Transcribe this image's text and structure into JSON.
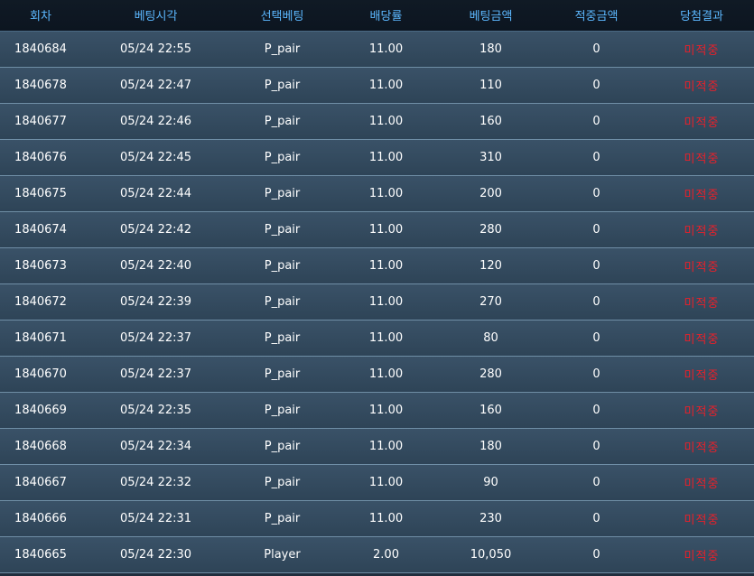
{
  "colors": {
    "header_text": "#5cb8ff",
    "row_text": "#ffffff",
    "result_lose": "#e8202a",
    "row_bg": "#34495e"
  },
  "headers": [
    "회차",
    "베팅시각",
    "선택베팅",
    "배당률",
    "베팅금액",
    "적중금액",
    "당첨결과"
  ],
  "rows": [
    {
      "round": "1840684",
      "time": "05/24 22:55",
      "pick": "P_pair",
      "odds": "11.00",
      "bet": "180",
      "win": "0",
      "result": "미적중"
    },
    {
      "round": "1840678",
      "time": "05/24 22:47",
      "pick": "P_pair",
      "odds": "11.00",
      "bet": "110",
      "win": "0",
      "result": "미적중"
    },
    {
      "round": "1840677",
      "time": "05/24 22:46",
      "pick": "P_pair",
      "odds": "11.00",
      "bet": "160",
      "win": "0",
      "result": "미적중"
    },
    {
      "round": "1840676",
      "time": "05/24 22:45",
      "pick": "P_pair",
      "odds": "11.00",
      "bet": "310",
      "win": "0",
      "result": "미적중"
    },
    {
      "round": "1840675",
      "time": "05/24 22:44",
      "pick": "P_pair",
      "odds": "11.00",
      "bet": "200",
      "win": "0",
      "result": "미적중"
    },
    {
      "round": "1840674",
      "time": "05/24 22:42",
      "pick": "P_pair",
      "odds": "11.00",
      "bet": "280",
      "win": "0",
      "result": "미적중"
    },
    {
      "round": "1840673",
      "time": "05/24 22:40",
      "pick": "P_pair",
      "odds": "11.00",
      "bet": "120",
      "win": "0",
      "result": "미적중"
    },
    {
      "round": "1840672",
      "time": "05/24 22:39",
      "pick": "P_pair",
      "odds": "11.00",
      "bet": "270",
      "win": "0",
      "result": "미적중"
    },
    {
      "round": "1840671",
      "time": "05/24 22:37",
      "pick": "P_pair",
      "odds": "11.00",
      "bet": "80",
      "win": "0",
      "result": "미적중"
    },
    {
      "round": "1840670",
      "time": "05/24 22:37",
      "pick": "P_pair",
      "odds": "11.00",
      "bet": "280",
      "win": "0",
      "result": "미적중"
    },
    {
      "round": "1840669",
      "time": "05/24 22:35",
      "pick": "P_pair",
      "odds": "11.00",
      "bet": "160",
      "win": "0",
      "result": "미적중"
    },
    {
      "round": "1840668",
      "time": "05/24 22:34",
      "pick": "P_pair",
      "odds": "11.00",
      "bet": "180",
      "win": "0",
      "result": "미적중"
    },
    {
      "round": "1840667",
      "time": "05/24 22:32",
      "pick": "P_pair",
      "odds": "11.00",
      "bet": "90",
      "win": "0",
      "result": "미적중"
    },
    {
      "round": "1840666",
      "time": "05/24 22:31",
      "pick": "P_pair",
      "odds": "11.00",
      "bet": "230",
      "win": "0",
      "result": "미적중"
    },
    {
      "round": "1840665",
      "time": "05/24 22:30",
      "pick": "Player",
      "odds": "2.00",
      "bet": "10,050",
      "win": "0",
      "result": "미적중"
    }
  ]
}
